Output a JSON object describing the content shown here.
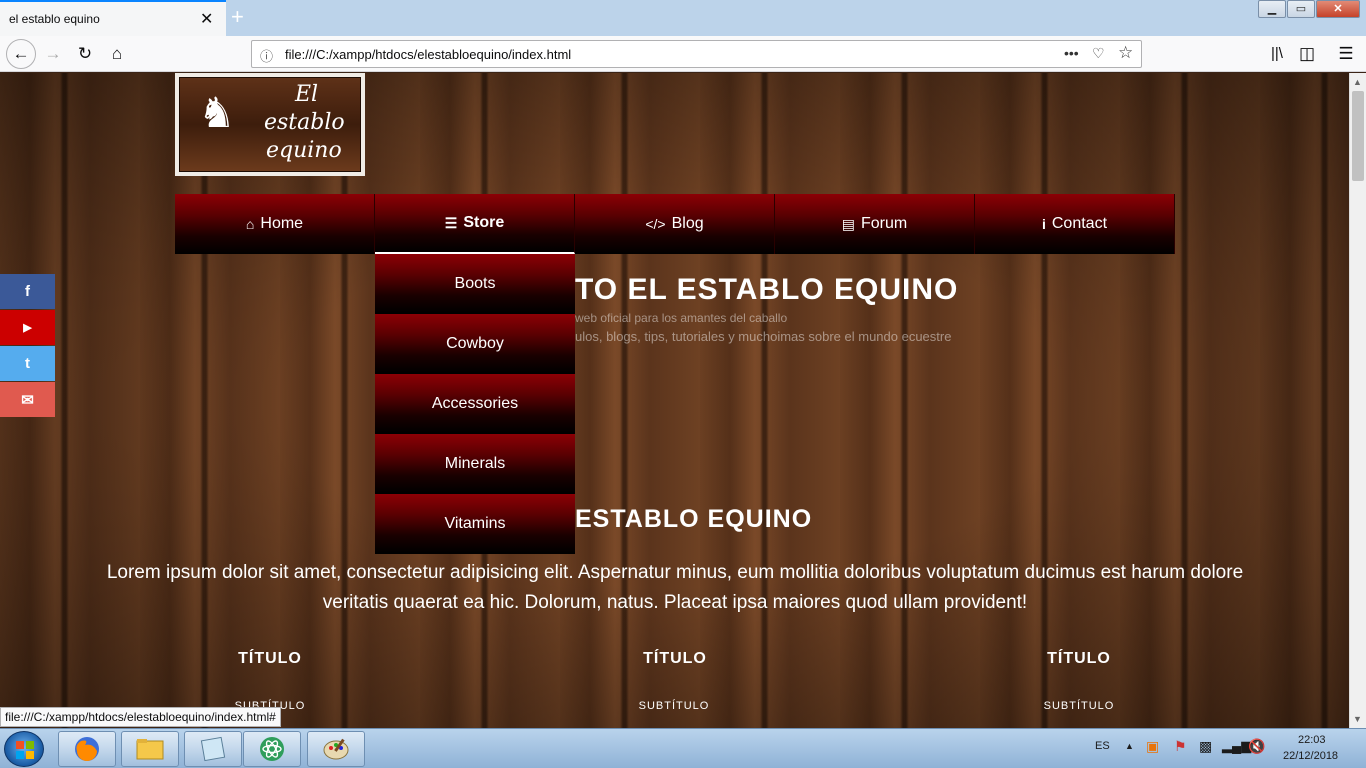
{
  "browser": {
    "tab_title": "el establo equino",
    "tab_close": "✕",
    "new_tab": "+",
    "url": "file:///C:/xampp/htdocs/elestabloequino/index.html",
    "status_url": "file:///C:/xampp/htdocs/elestabloequino/index.html#",
    "window_buttons": {
      "minimize": "▁",
      "maximize": "▭",
      "close": "✕"
    },
    "icons": [
      "back-arrow-icon",
      "forward-arrow-icon",
      "reload-icon",
      "home-icon",
      "info-icon",
      "more-icon",
      "pocket-icon",
      "bookmark-star-icon",
      "library-icon",
      "sidebar-icon",
      "hamburger-menu-icon"
    ]
  },
  "site": {
    "logo": {
      "line1": "El",
      "line2": "establo",
      "line3": "equino"
    },
    "menu": [
      {
        "label": "Home",
        "icon": "home-icon"
      },
      {
        "label": "Store",
        "icon": "list-icon"
      },
      {
        "label": "Blog",
        "icon": "code-icon"
      },
      {
        "label": "Forum",
        "icon": "document-icon"
      },
      {
        "label": "Contact",
        "icon": "info-icon"
      }
    ],
    "dropdown": [
      "Boots",
      "Cowboy",
      "Accessories",
      "Minerals",
      "Vitamins"
    ],
    "hero": {
      "title": "TO EL ESTABLO EQUINO",
      "sub1": "web oficial para los amantes del caballo",
      "sub2": "ulos, blogs, tips, tutoriales y muchoimas sobre el mundo ecuestre"
    },
    "section": {
      "title": "ESTABLO EQUINO",
      "text": "Lorem ipsum dolor sit amet, consectetur adipisicing elit. Aspernatur minus, eum mollitia doloribus voluptatum ducimus est harum dolore veritatis quaerat ea hic. Dolorum, natus. Placeat ipsa maiores quod ullam provident!"
    },
    "columns": [
      {
        "title": "TÍTULO",
        "subtitle": "SUBTÍTULO"
      },
      {
        "title": "TÍTULO",
        "subtitle": "SUBTÍTULO"
      },
      {
        "title": "TÍTULO",
        "subtitle": "SUBTÍTULO"
      }
    ],
    "social": [
      {
        "label": "f",
        "icon": "facebook-icon",
        "color": "#3b5998"
      },
      {
        "label": "▶",
        "icon": "youtube-icon",
        "color": "#cc0000"
      },
      {
        "label": "t",
        "icon": "twitter-icon",
        "color": "#55acee"
      },
      {
        "label": "✉",
        "icon": "mail-icon",
        "color": "#e05a4f"
      }
    ]
  },
  "taskbar": {
    "lang": "ES",
    "time": "22:03",
    "date": "22/12/2018",
    "apps": [
      "firefox-icon",
      "file-explorer-icon",
      "notepad-icon",
      "atom-icon",
      "paint-icon"
    ]
  }
}
